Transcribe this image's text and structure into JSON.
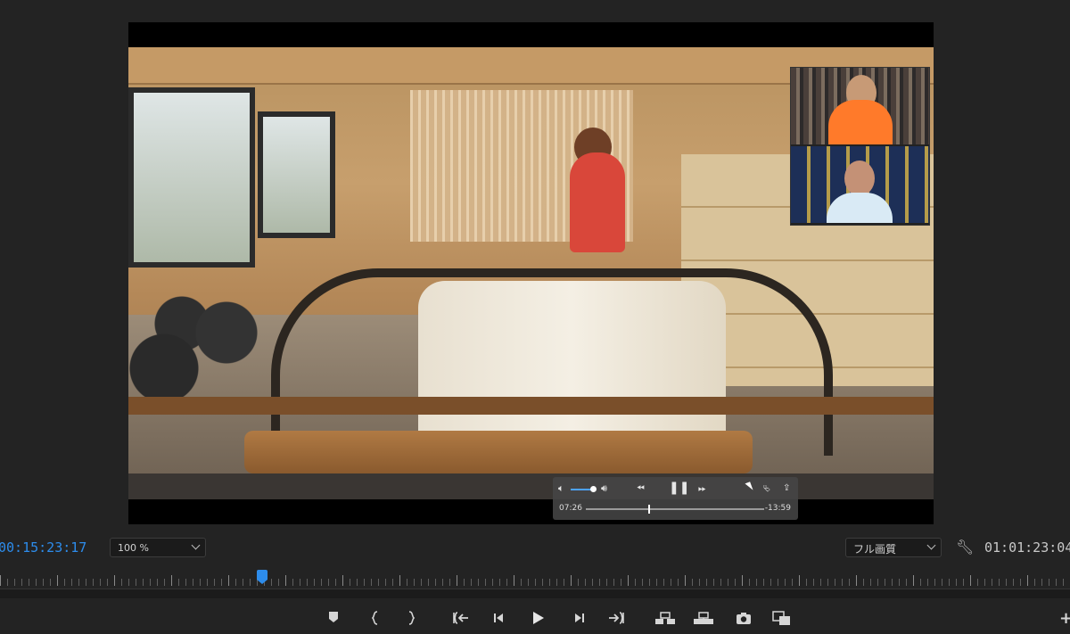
{
  "viewer": {
    "timecode_current": "00:15:23:17",
    "zoom": "100 %",
    "quality": "フル画質",
    "timecode_duration": "01:01:23:04"
  },
  "playback_overlay": {
    "time_elapsed": "07:26",
    "time_remaining": "-13:59",
    "volume_level": 0.9,
    "progress": 0.35,
    "icons": [
      "speaker-icon",
      "rewind-icon",
      "pause-icon",
      "fast-forward-icon",
      "pip-icon",
      "share-icon"
    ]
  },
  "transport_buttons": [
    {
      "name": "add-marker-button",
      "icon": "marker-icon"
    },
    {
      "name": "mark-in-button",
      "icon": "mark-in-icon"
    },
    {
      "name": "mark-out-button",
      "icon": "mark-out-icon"
    },
    {
      "name": "go-to-in-button",
      "icon": "go-to-in-icon"
    },
    {
      "name": "step-back-button",
      "icon": "step-back-icon"
    },
    {
      "name": "play-button",
      "icon": "play-icon"
    },
    {
      "name": "step-forward-button",
      "icon": "step-forward-icon"
    },
    {
      "name": "go-to-out-button",
      "icon": "go-to-out-icon"
    },
    {
      "name": "insert-button",
      "icon": "insert-icon"
    },
    {
      "name": "overwrite-button",
      "icon": "overwrite-icon"
    },
    {
      "name": "export-frame-button",
      "icon": "camera-icon"
    },
    {
      "name": "compare-view-button",
      "icon": "compare-icon"
    }
  ],
  "colors": {
    "accent": "#2d8ceb",
    "panel_bg": "#232323"
  },
  "timeline": {
    "playhead_position": 0.245
  }
}
